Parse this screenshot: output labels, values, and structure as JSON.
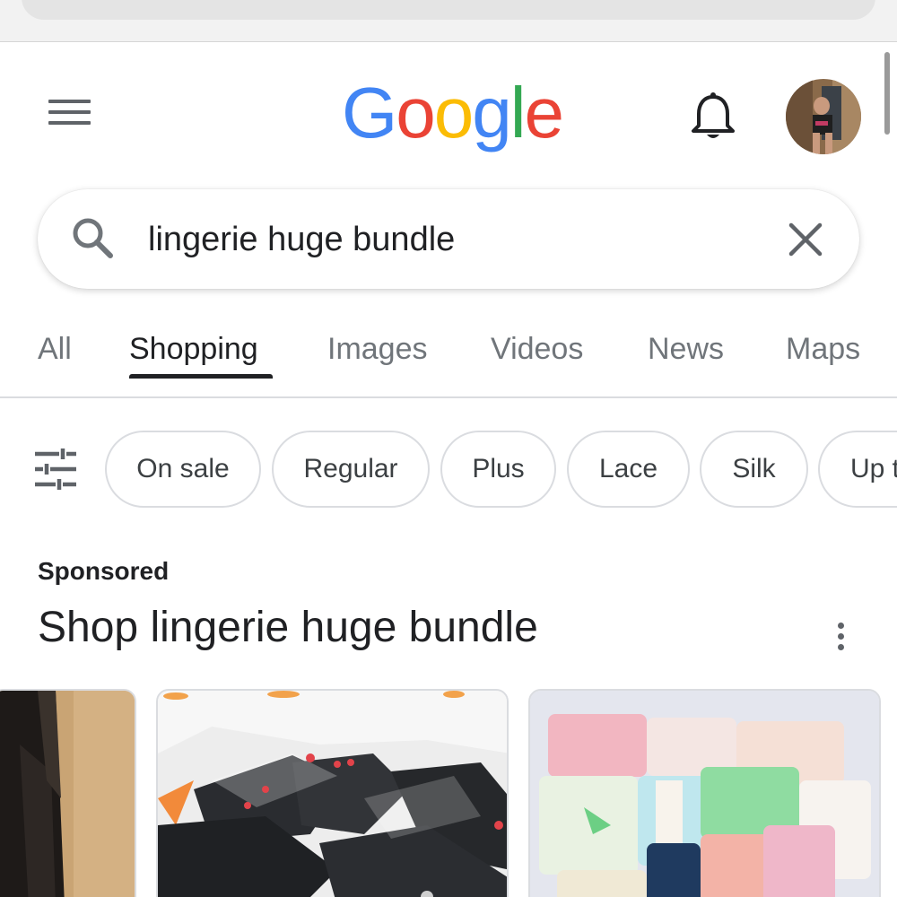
{
  "header": {
    "logo_letters": [
      "G",
      "o",
      "o",
      "g",
      "l",
      "e"
    ],
    "menu_icon": "hamburger-menu-icon",
    "notifications_icon": "bell-icon",
    "avatar": "profile-avatar"
  },
  "search": {
    "query": "lingerie huge bundle",
    "search_icon": "search-icon",
    "clear_icon": "close-icon"
  },
  "tabs": [
    {
      "label": "All",
      "active": false
    },
    {
      "label": "Shopping",
      "active": true
    },
    {
      "label": "Images",
      "active": false
    },
    {
      "label": "Videos",
      "active": false
    },
    {
      "label": "News",
      "active": false
    },
    {
      "label": "Maps",
      "active": false
    }
  ],
  "filters": {
    "icon": "tune-sliders-icon",
    "chips": [
      "On sale",
      "Regular",
      "Plus",
      "Lace",
      "Silk",
      "Up t"
    ]
  },
  "sponsored": {
    "label": "Sponsored",
    "title": "Shop lingerie huge bundle",
    "more_icon": "more-vert-icon"
  },
  "colors": {
    "google_blue": "#4285f4",
    "google_red": "#ea4335",
    "google_yellow": "#fbbc05",
    "google_green": "#34a853",
    "text_primary": "#202124",
    "text_secondary": "#70757a",
    "chip_border": "#dadce0"
  }
}
